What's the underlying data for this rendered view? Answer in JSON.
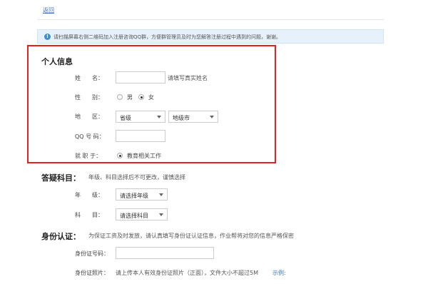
{
  "nav": {
    "back_label": "返回"
  },
  "notice": {
    "text": "请扫描屏幕右侧二维码加入注册咨询QQ群，方便群管理员及时为您解答注册过程中遇到的问题，谢谢。"
  },
  "personal": {
    "title": "个人信息",
    "name": {
      "label": "姓　　名：",
      "value": "",
      "hint": "请填写真实姓名"
    },
    "gender": {
      "label": "性　　别：",
      "options": [
        "男",
        "女"
      ],
      "selected": "女"
    },
    "region": {
      "label": "地　　区：",
      "province": "省级",
      "city": "地级市"
    },
    "qq": {
      "label": "QQ 号 码：",
      "value": ""
    },
    "job": {
      "label": "就 职 于：",
      "option": "教育相关工作",
      "selected": true
    }
  },
  "subject": {
    "title": "答疑科目：",
    "note": "年级、科目选择后不可更改，谨慎选择",
    "grade": {
      "label": "年　　级：",
      "value": "请选择年级"
    },
    "course": {
      "label": "科　　目：",
      "value": "请选择科目"
    }
  },
  "identity": {
    "title": "身份认证：",
    "note": "为保证工资及时发放，请认真填写身份证认证信息，作业帮将对您的信息严格保密",
    "id_number": {
      "label": "身份证号码：",
      "value": ""
    },
    "photo": {
      "label": "身份证照片：",
      "hint": "请上传本人有效身份证照片（正面），文件大小不超过5M",
      "example_label": "示例:"
    }
  },
  "colors": {
    "link": "#3b73c4",
    "highlight_border": "#e62020",
    "notice_bg": "#e7f1fb"
  }
}
